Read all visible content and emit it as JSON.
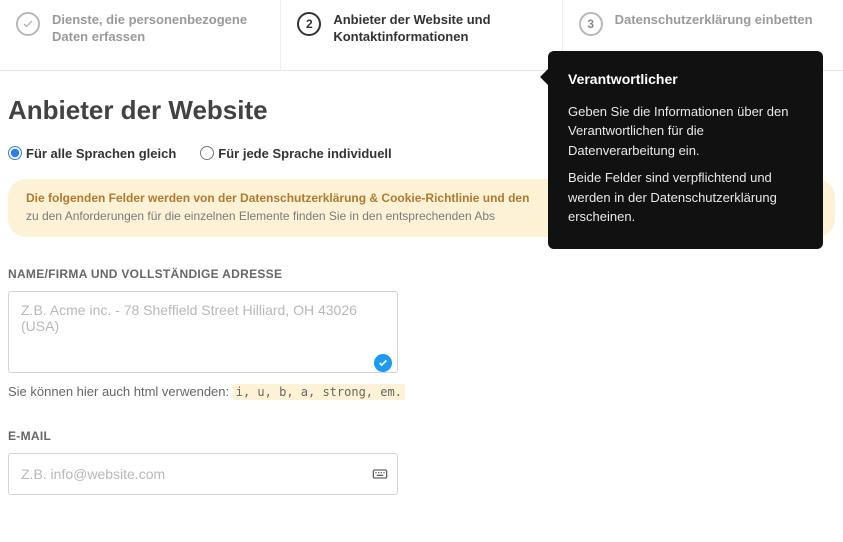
{
  "steps": {
    "s1": {
      "title": "Dienste, die personenbezogene Daten erfassen"
    },
    "s2": {
      "num": "2",
      "title": "Anbieter der Website und Kontaktinformationen"
    },
    "s3": {
      "num": "3",
      "title": "Datenschutzerklärung einbetten"
    }
  },
  "heading": "Anbieter der Website",
  "radios": {
    "all": "Für alle Sprachen gleich",
    "each": "Für jede Sprache individuell"
  },
  "banner": {
    "bold": "Die folgenden Felder werden von der Datenschutzerklärung & Cookie-Richtlinie und den",
    "sub": "zu den Anforderungen für die einzelnen Elemente finden Sie in den entsprechenden Abs"
  },
  "field1": {
    "label": "NAME/FIRMA UND VOLLSTÄNDIGE ADRESSE",
    "placeholder": "Z.B. Acme inc. - 78 Sheffield Street Hilliard, OH 43026 (USA)"
  },
  "hint": {
    "prefix": "Sie können hier auch html verwenden: ",
    "code": "i, u, b, a, strong, em."
  },
  "field2": {
    "label": "E-MAIL",
    "placeholder": "Z.B. info@website.com"
  },
  "tooltip": {
    "title": "Verantwortlicher",
    "p1": "Geben Sie die Informationen über den Verantwortlichen für die Datenverarbeitung ein.",
    "p2": "Beide Felder sind verpflichtend und werden in der Datenschutzerklärung erscheinen."
  }
}
